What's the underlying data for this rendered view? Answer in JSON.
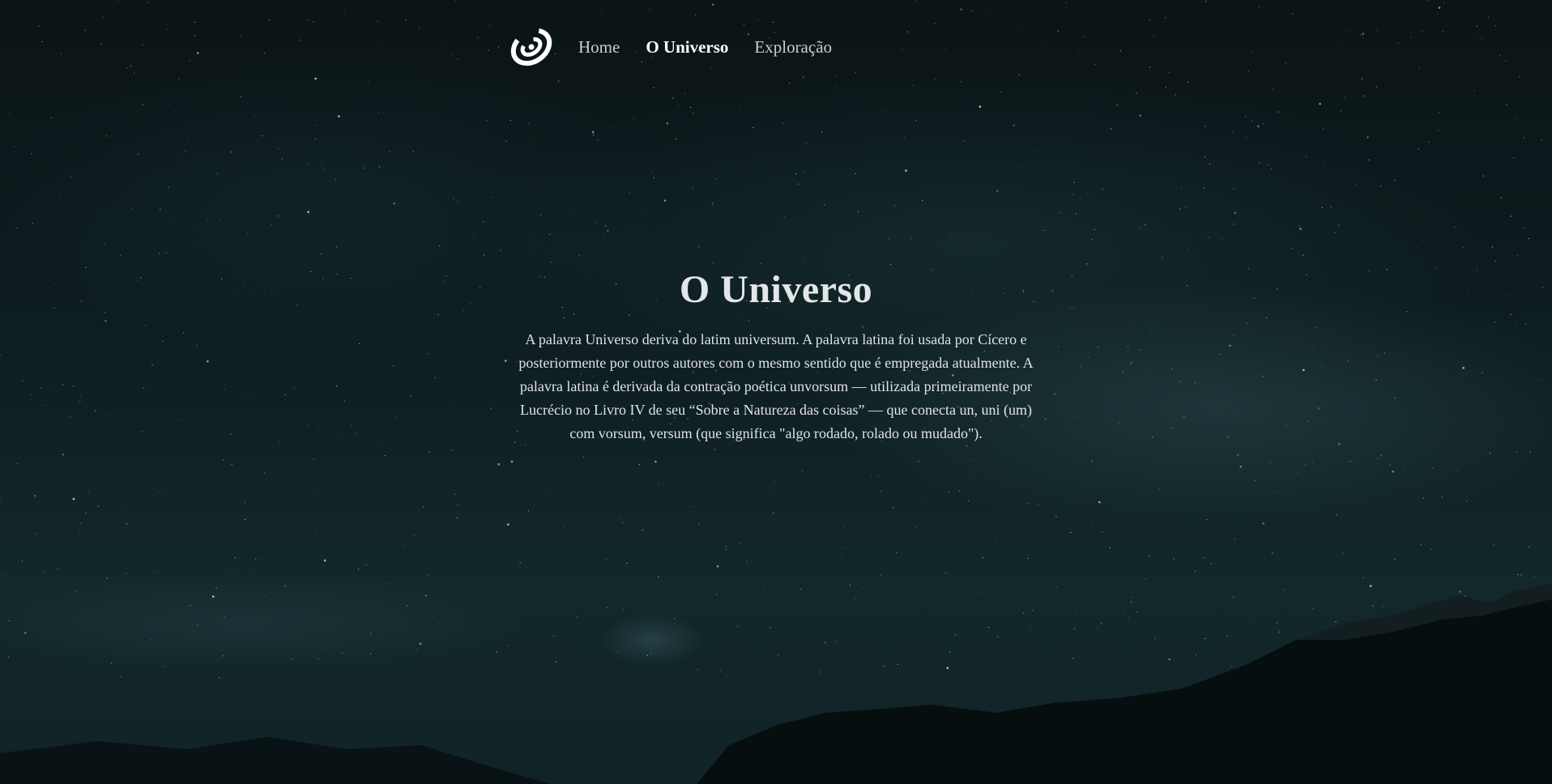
{
  "nav": {
    "logo_icon": "galaxy-swirl-icon",
    "items": [
      {
        "label": "Home",
        "active": false
      },
      {
        "label": "O Universo",
        "active": true
      },
      {
        "label": "Exploração",
        "active": false
      }
    ]
  },
  "hero": {
    "title": "O Universo",
    "body": "A palavra Universo deriva do latim universum. A palavra latina foi usada por Cícero e posteriormente por outros autores com o mesmo sentido que é empregada atualmente. A palavra latina é derivada da contração poética unvorsum — utilizada primeiramente por Lucrécio no Livro IV de seu “Sobre a Natureza das coisas” — que conecta un, uni (um) com vorsum, versum (que significa \"algo rodado, rolado ou mudado\")."
  },
  "colors": {
    "sky": "#0c1a1d",
    "text": "#e0e3e4",
    "nav_text": "#c9cfd1",
    "nav_active": "#ffffff"
  }
}
